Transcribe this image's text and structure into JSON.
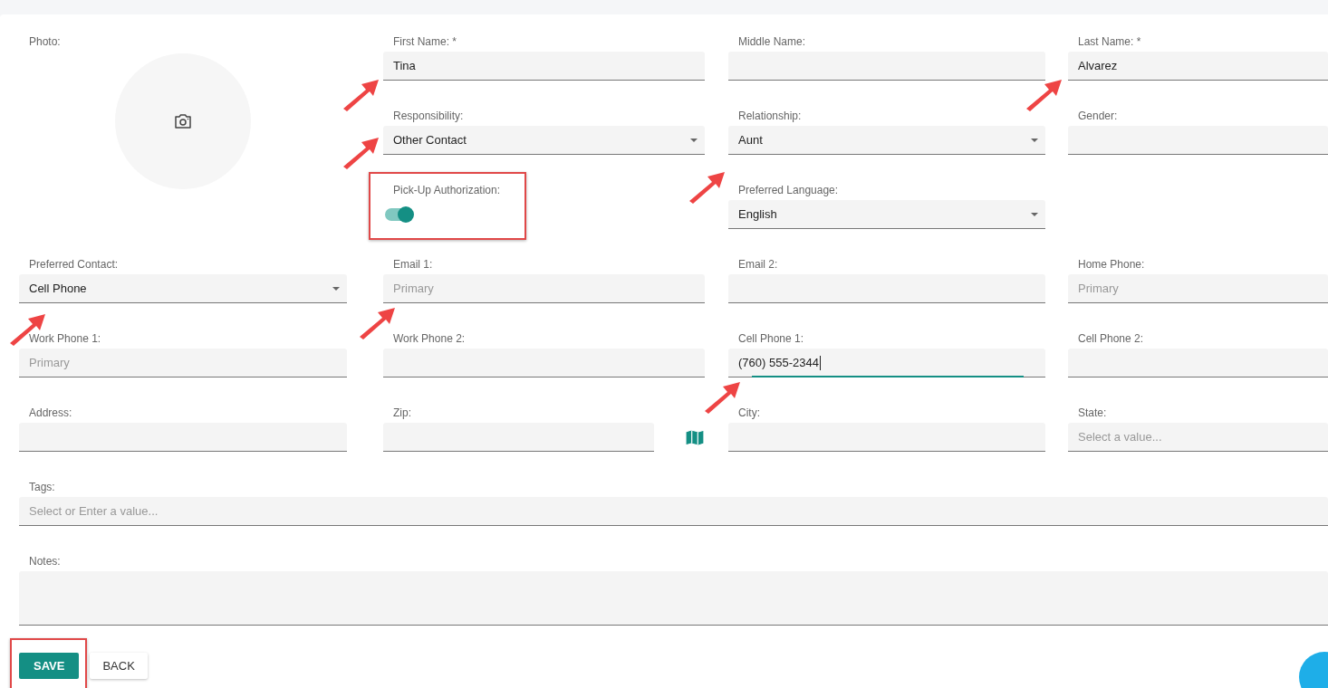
{
  "photo": {
    "label": "Photo:"
  },
  "top_rows": [
    [
      {
        "kind": "text",
        "label": "First Name: *",
        "value": "Tina"
      },
      {
        "kind": "text",
        "label": "Middle Name:"
      },
      {
        "kind": "text",
        "label": "Last Name: *",
        "value": "Alvarez"
      }
    ],
    [
      {
        "kind": "select",
        "label": "Responsibility:",
        "value": "Other Contact"
      },
      {
        "kind": "select",
        "label": "Relationship:",
        "value": "Aunt"
      },
      {
        "kind": "text",
        "label": "Gender:"
      }
    ],
    [
      {
        "kind": "toggle",
        "label": "Pick-Up Authorization:",
        "on": true
      },
      {
        "kind": "select",
        "label": "Preferred Language:",
        "value": "English"
      }
    ]
  ],
  "rows": [
    [
      {
        "kind": "select",
        "label": "Preferred Contact:",
        "value": "Cell Phone"
      },
      {
        "kind": "text",
        "label": "Email 1:",
        "placeholder": "Primary"
      },
      {
        "kind": "text",
        "label": "Email 2:"
      },
      {
        "kind": "text",
        "label": "Home Phone:",
        "placeholder": "Primary"
      }
    ],
    [
      {
        "kind": "text",
        "label": "Work Phone 1:",
        "placeholder": "Primary"
      },
      {
        "kind": "text",
        "label": "Work Phone 2:"
      },
      {
        "kind": "text",
        "label": "Cell Phone 1:",
        "value": "(760) 555-2344",
        "focused": true
      },
      {
        "kind": "text",
        "label": "Cell Phone 2:"
      }
    ],
    [
      {
        "kind": "text",
        "label": "Address:"
      },
      {
        "kind": "zip",
        "label": "Zip:"
      },
      {
        "kind": "text",
        "label": "City:"
      },
      {
        "kind": "text",
        "label": "State:",
        "placeholder": "Select a value..."
      }
    ]
  ],
  "tags": {
    "label": "Tags:",
    "placeholder": "Select or Enter a value..."
  },
  "notes": {
    "label": "Notes:"
  },
  "buttons": [
    {
      "kind": "primary",
      "label": "SAVE"
    },
    {
      "kind": "plain",
      "label": "BACK"
    }
  ]
}
